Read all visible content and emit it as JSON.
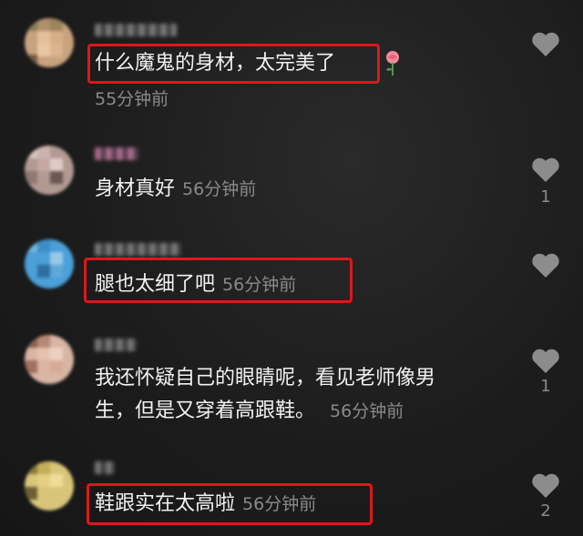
{
  "comments": [
    {
      "text": "什么魔鬼的身材，太完美了",
      "time": "55分钟前",
      "likes": "",
      "emoji": "rose-icon"
    },
    {
      "text": "身材真好",
      "time": "56分钟前",
      "likes": "1"
    },
    {
      "text": "腿也太细了吧",
      "time": "56分钟前",
      "likes": ""
    },
    {
      "text_line1": "我还怀疑自己的眼睛呢，看见老师像男",
      "text_line2": "生，但是又穿着高跟鞋。",
      "time": "56分钟前",
      "likes": "1"
    },
    {
      "text": "鞋跟实在太高啦",
      "time": "56分钟前",
      "likes": "2"
    }
  ],
  "colors": {
    "highlight": "#e0161b",
    "text": "#f2f2f2",
    "muted": "#8a8a8a",
    "background": "#1c1c1c"
  }
}
